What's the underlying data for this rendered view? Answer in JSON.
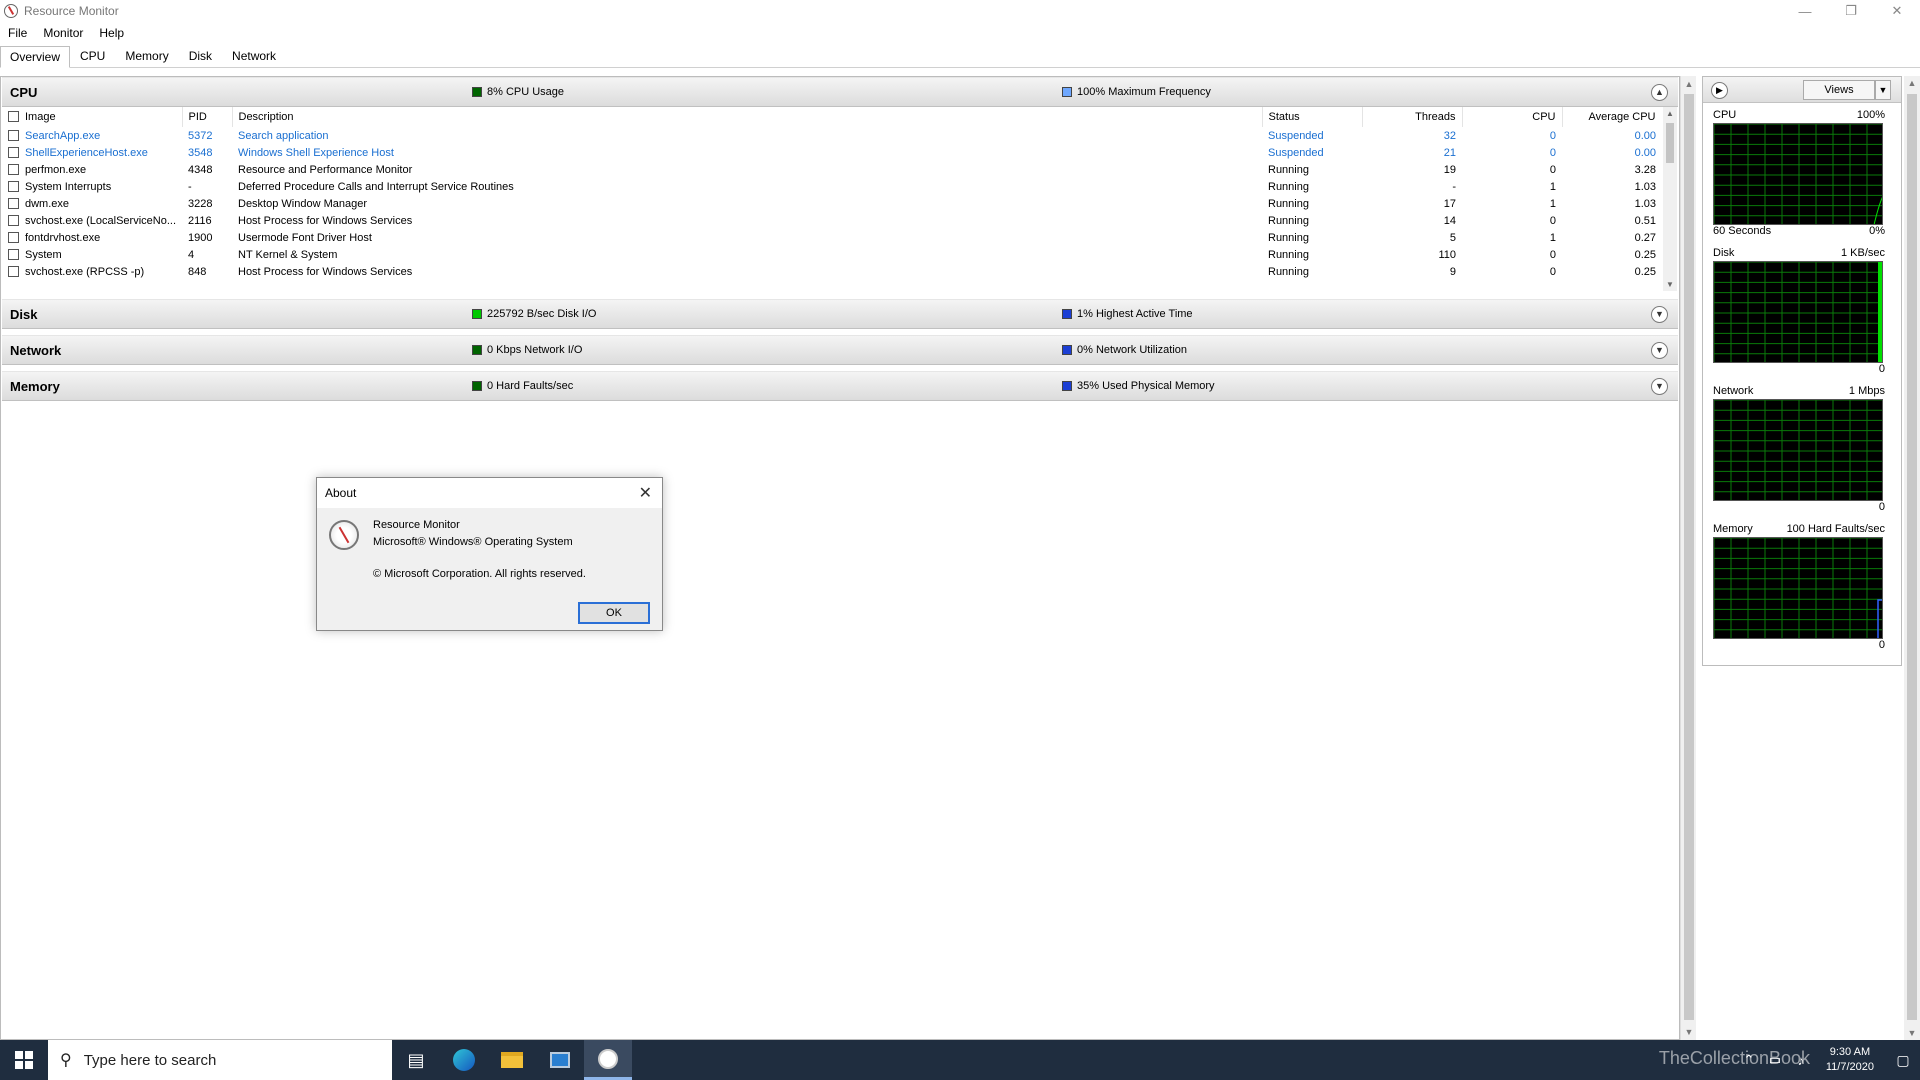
{
  "window": {
    "title": "Resource Monitor",
    "min": "—",
    "max": "❐",
    "close": "✕"
  },
  "menu": [
    "File",
    "Monitor",
    "Help"
  ],
  "tabs": [
    "Overview",
    "CPU",
    "Memory",
    "Disk",
    "Network"
  ],
  "cpu": {
    "title": "CPU",
    "legend1": "8% CPU Usage",
    "legend2": "100% Maximum Frequency",
    "columns": [
      "Image",
      "PID",
      "Description",
      "Status",
      "Threads",
      "CPU",
      "Average CPU"
    ],
    "rows": [
      [
        "SearchApp.exe",
        "5372",
        "Search application",
        "Suspended",
        "32",
        "0",
        "0.00"
      ],
      [
        "ShellExperienceHost.exe",
        "3548",
        "Windows Shell Experience Host",
        "Suspended",
        "21",
        "0",
        "0.00"
      ],
      [
        "perfmon.exe",
        "4348",
        "Resource and Performance Monitor",
        "Running",
        "19",
        "0",
        "3.28"
      ],
      [
        "System Interrupts",
        "-",
        "Deferred Procedure Calls and Interrupt Service Routines",
        "Running",
        "-",
        "1",
        "1.03"
      ],
      [
        "dwm.exe",
        "3228",
        "Desktop Window Manager",
        "Running",
        "17",
        "1",
        "1.03"
      ],
      [
        "svchost.exe (LocalServiceNo...",
        "2116",
        "Host Process for Windows Services",
        "Running",
        "14",
        "0",
        "0.51"
      ],
      [
        "fontdrvhost.exe",
        "1900",
        "Usermode Font Driver Host",
        "Running",
        "5",
        "1",
        "0.27"
      ],
      [
        "System",
        "4",
        "NT Kernel & System",
        "Running",
        "110",
        "0",
        "0.25"
      ],
      [
        "svchost.exe (RPCSS -p)",
        "848",
        "Host Process for Windows Services",
        "Running",
        "9",
        "0",
        "0.25"
      ]
    ]
  },
  "disk": {
    "title": "Disk",
    "legend1": "225792 B/sec Disk I/O",
    "legend2": "1% Highest Active Time"
  },
  "network": {
    "title": "Network",
    "legend1": "0 Kbps Network I/O",
    "legend2": "0% Network Utilization"
  },
  "memory": {
    "title": "Memory",
    "legend1": "0 Hard Faults/sec",
    "legend2": "35% Used Physical Memory"
  },
  "colors": {
    "green": "#00c800",
    "darkgreen": "#006400",
    "blue": "#1c3fd4",
    "lightblue": "#6fa8ff",
    "link": "#1a6fd1"
  },
  "graphs": {
    "views": "Views",
    "cpu": {
      "label": "CPU",
      "max": "100%",
      "foot_left": "60 Seconds",
      "foot_right": "0%"
    },
    "disk": {
      "label": "Disk",
      "max": "1 KB/sec",
      "foot_right": "0"
    },
    "network": {
      "label": "Network",
      "max": "1 Mbps",
      "foot_right": "0"
    },
    "memory": {
      "label": "Memory",
      "max": "100 Hard Faults/sec",
      "foot_right": "0"
    }
  },
  "about": {
    "title": "About",
    "line1": "Resource Monitor",
    "line2": "Microsoft® Windows® Operating System",
    "line3": "© Microsoft Corporation. All rights reserved.",
    "ok": "OK"
  },
  "taskbar": {
    "search_placeholder": "Type here to search",
    "time": "9:30 AM",
    "date": "11/7/2020",
    "watermark": "TheCollectionBook"
  }
}
